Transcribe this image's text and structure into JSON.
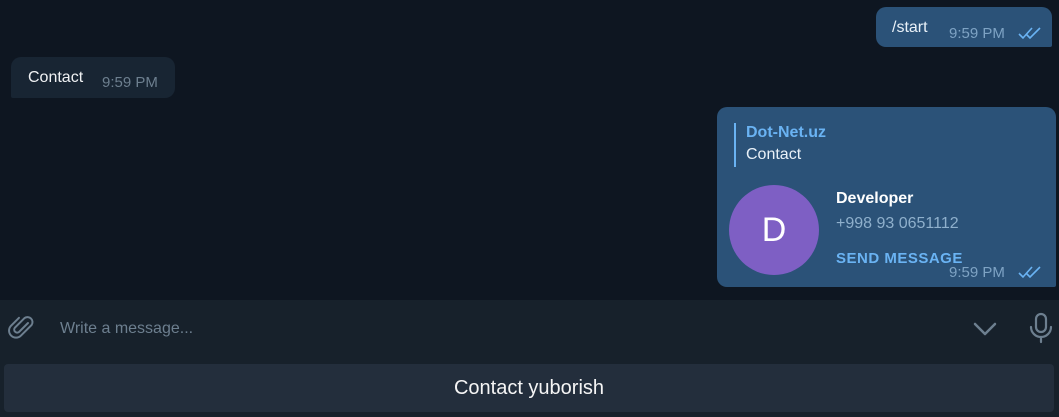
{
  "messages": {
    "start": {
      "text": "/start",
      "time": "9:59 PM"
    },
    "contact_in": {
      "text": "Contact",
      "time": "9:59 PM"
    },
    "contact_card": {
      "reply_from": "Dot-Net.uz",
      "reply_text": "Contact",
      "avatar_letter": "D",
      "name": "Developer",
      "phone": "+998 93 0651112",
      "action": "SEND MESSAGE",
      "time": "9:59 PM"
    }
  },
  "composer": {
    "placeholder": "Write a message..."
  },
  "keyboard": {
    "button_label": "Contact yuborish"
  },
  "colors": {
    "accent": "#6ab3f3",
    "outgoing_bubble": "#2b5278",
    "incoming_bubble": "#182533",
    "avatar": "#7e5fc4",
    "background": "#0e1621"
  },
  "icons": [
    "paperclip-icon",
    "chevron-down-icon",
    "microphone-icon",
    "double-check-icon"
  ]
}
